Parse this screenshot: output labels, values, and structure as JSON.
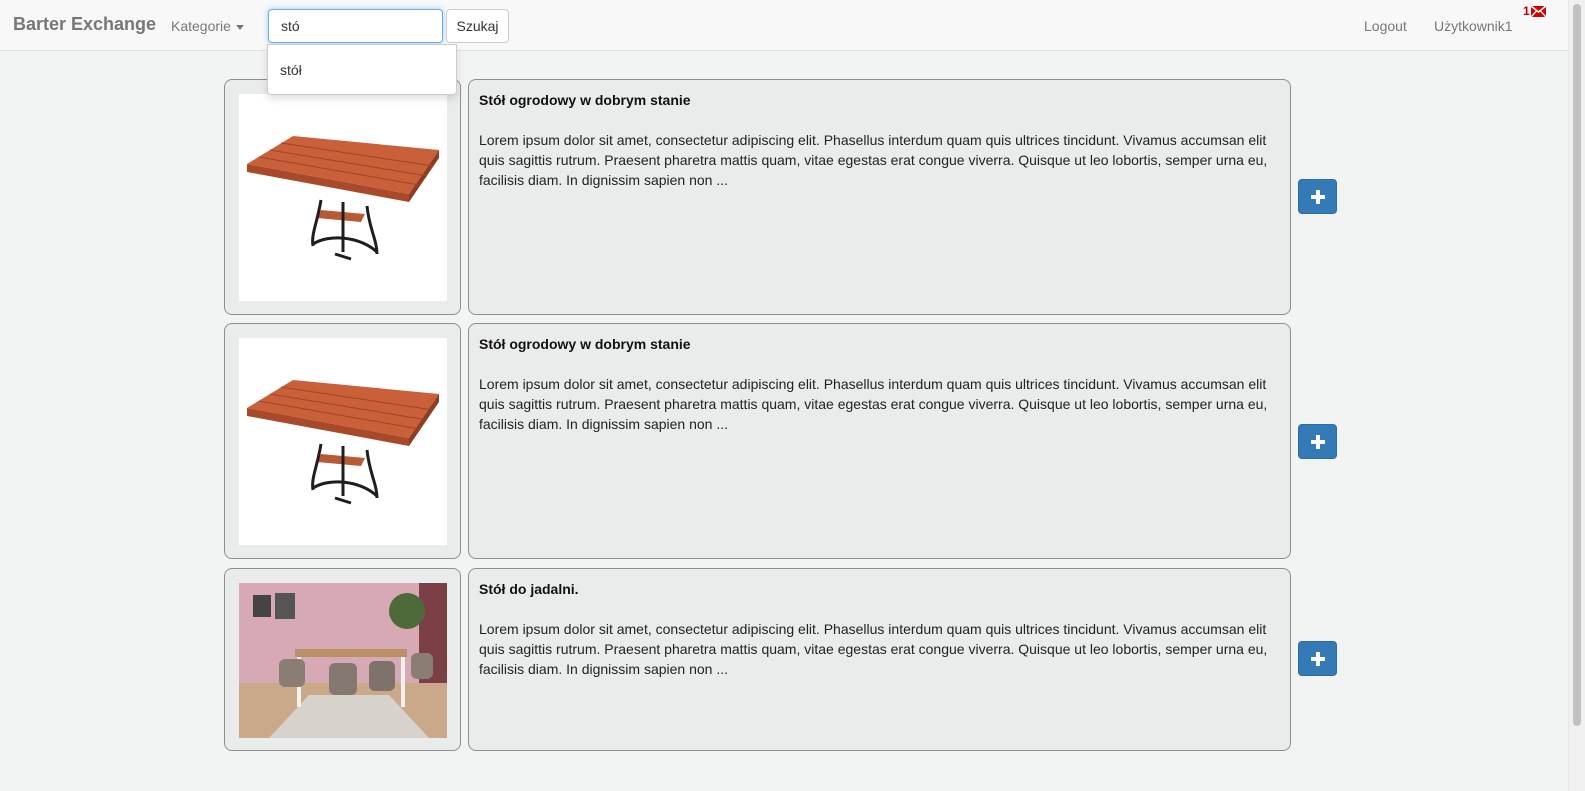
{
  "navbar": {
    "brand": "Barter Exchange",
    "categories_label": "Kategorie",
    "logout_label": "Logout",
    "user_label": "Użytkownik1",
    "message_count": "1"
  },
  "search": {
    "value": "stó",
    "button_label": "Szukaj",
    "suggestions": [
      "stół"
    ]
  },
  "listings": [
    {
      "title": "Stół ogrodowy w dobrym stanie",
      "description": "Lorem ipsum dolor sit amet, consectetur adipiscing elit. Phasellus interdum quam quis ultrices tincidunt. Vivamus accumsan elit quis sagittis rutrum. Praesent pharetra mattis quam, vitae egestas erat congue viverra. Quisque ut leo lobortis, semper urna eu, facilisis diam. In dignissim sapien non ...",
      "image": "garden-table"
    },
    {
      "title": "Stół ogrodowy w dobrym stanie",
      "description": "Lorem ipsum dolor sit amet, consectetur adipiscing elit. Phasellus interdum quam quis ultrices tincidunt. Vivamus accumsan elit quis sagittis rutrum. Praesent pharetra mattis quam, vitae egestas erat congue viverra. Quisque ut leo lobortis, semper urna eu, facilisis diam. In dignissim sapien non ...",
      "image": "garden-table"
    },
    {
      "title": "Stół do jadalni.",
      "description": "Lorem ipsum dolor sit amet, consectetur adipiscing elit. Phasellus interdum quam quis ultrices tincidunt. Vivamus accumsan elit quis sagittis rutrum. Praesent pharetra mattis quam, vitae egestas erat congue viverra. Quisque ut leo lobortis, semper urna eu, facilisis diam. In dignissim sapien non ...",
      "image": "dining-set"
    }
  ],
  "icons": {
    "add": "plus-icon",
    "message": "envelope-icon",
    "dropdown": "caret-down-icon"
  },
  "colors": {
    "primary_button": "#337ab7",
    "message_badge": "#c40000"
  }
}
